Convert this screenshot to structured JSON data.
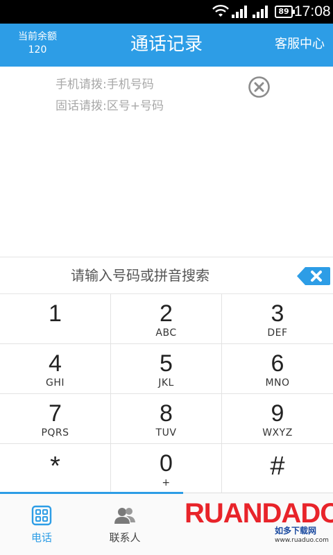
{
  "status_bar": {
    "battery": "89",
    "time": "17:08"
  },
  "header": {
    "balance_label": "当前余额",
    "balance_value": "120",
    "title": "通话记录",
    "service": "客服中心"
  },
  "hints": {
    "mobile": "手机请拨:手机号码",
    "landline": "固话请拨:区号+号码"
  },
  "search": {
    "placeholder": "请输入号码或拼音搜索"
  },
  "keypad": [
    {
      "digit": "1",
      "letters": ""
    },
    {
      "digit": "2",
      "letters": "ABC"
    },
    {
      "digit": "3",
      "letters": "DEF"
    },
    {
      "digit": "4",
      "letters": "GHI"
    },
    {
      "digit": "5",
      "letters": "JKL"
    },
    {
      "digit": "6",
      "letters": "MNO"
    },
    {
      "digit": "7",
      "letters": "PQRS"
    },
    {
      "digit": "8",
      "letters": "TUV"
    },
    {
      "digit": "9",
      "letters": "WXYZ"
    },
    {
      "digit": "*",
      "letters": ""
    },
    {
      "digit": "0",
      "letters": "+"
    },
    {
      "digit": "#",
      "letters": ""
    }
  ],
  "tabs": [
    {
      "label": "电话",
      "icon": "dialpad-icon"
    },
    {
      "label": "联系人",
      "icon": "contacts-icon"
    }
  ],
  "watermark": {
    "brand": "RUANDADO",
    "sub": "如多下载网",
    "url": "www.ruaduo.com"
  },
  "colors": {
    "accent": "#2d9de6",
    "hint_text": "#a8a8a8"
  }
}
